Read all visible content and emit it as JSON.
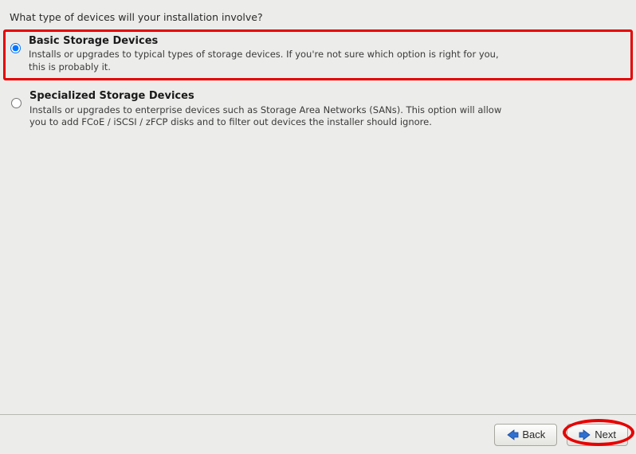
{
  "question": "What type of devices will your installation involve?",
  "options": [
    {
      "title": "Basic Storage Devices",
      "desc": "Installs or upgrades to typical types of storage devices.  If you're not sure which option is right for you, this is probably it.",
      "selected": true,
      "highlighted": true
    },
    {
      "title": "Specialized Storage Devices",
      "desc": "Installs or upgrades to enterprise devices such as Storage Area Networks (SANs). This option will allow you to add FCoE / iSCSI / zFCP disks and to filter out devices the installer should ignore.",
      "selected": false,
      "highlighted": false
    }
  ],
  "buttons": {
    "back": "Back",
    "next": "Next"
  },
  "annotations": {
    "next_circled": true
  }
}
